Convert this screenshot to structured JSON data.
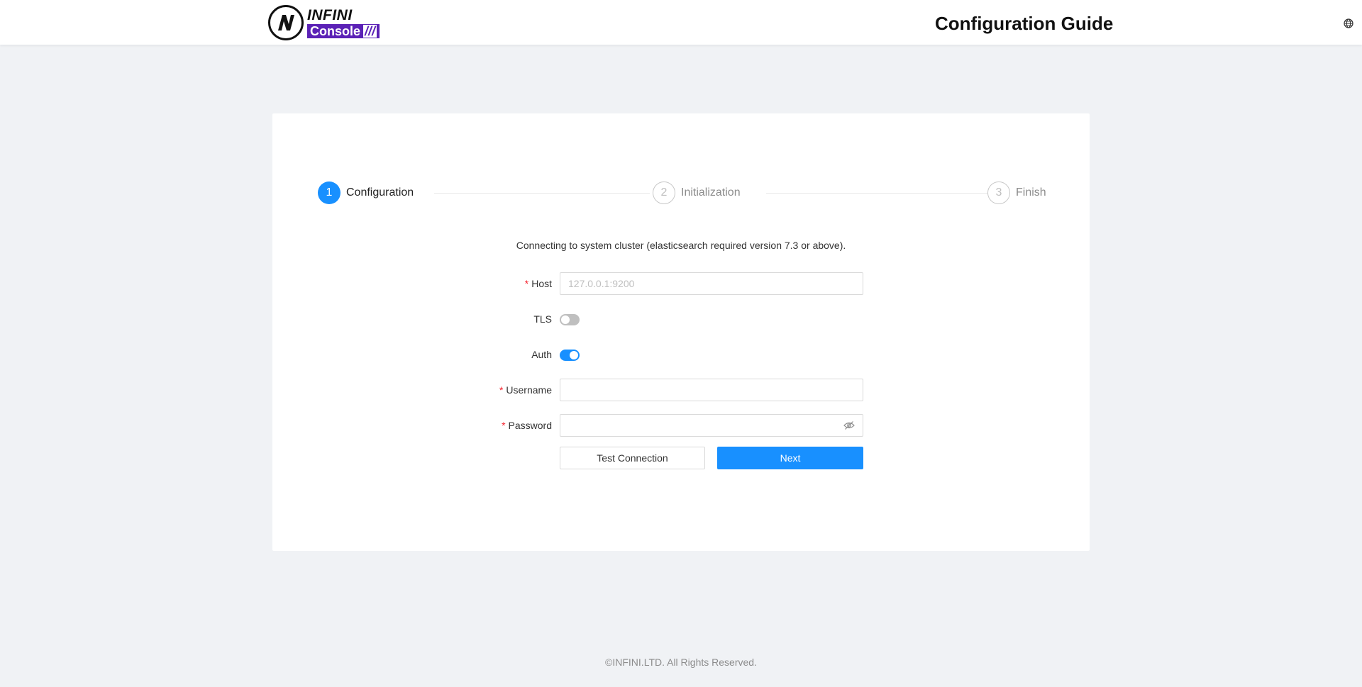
{
  "header": {
    "logo_top": "INFINI",
    "logo_bottom": "Console",
    "logo_stripes": "///",
    "title": "Configuration Guide"
  },
  "steps": [
    {
      "number": "1",
      "label": "Configuration",
      "status": "active"
    },
    {
      "number": "2",
      "label": "Initialization",
      "status": "wait"
    },
    {
      "number": "3",
      "label": "Finish",
      "status": "wait"
    }
  ],
  "form": {
    "intro": "Connecting to system cluster (elasticsearch required version 7.3 or above).",
    "required_mark": "*",
    "host": {
      "label": "Host",
      "placeholder": "127.0.0.1:9200",
      "value": ""
    },
    "tls": {
      "label": "TLS",
      "enabled": false
    },
    "auth": {
      "label": "Auth",
      "enabled": true
    },
    "username": {
      "label": "Username",
      "value": ""
    },
    "password": {
      "label": "Password",
      "value": ""
    },
    "test_button": "Test Connection",
    "next_button": "Next"
  },
  "footer": {
    "copyright": "©INFINI.LTD. All Rights Reserved."
  },
  "colors": {
    "primary": "#1890ff",
    "brand": "#5b21b6",
    "required": "#f5222d"
  }
}
